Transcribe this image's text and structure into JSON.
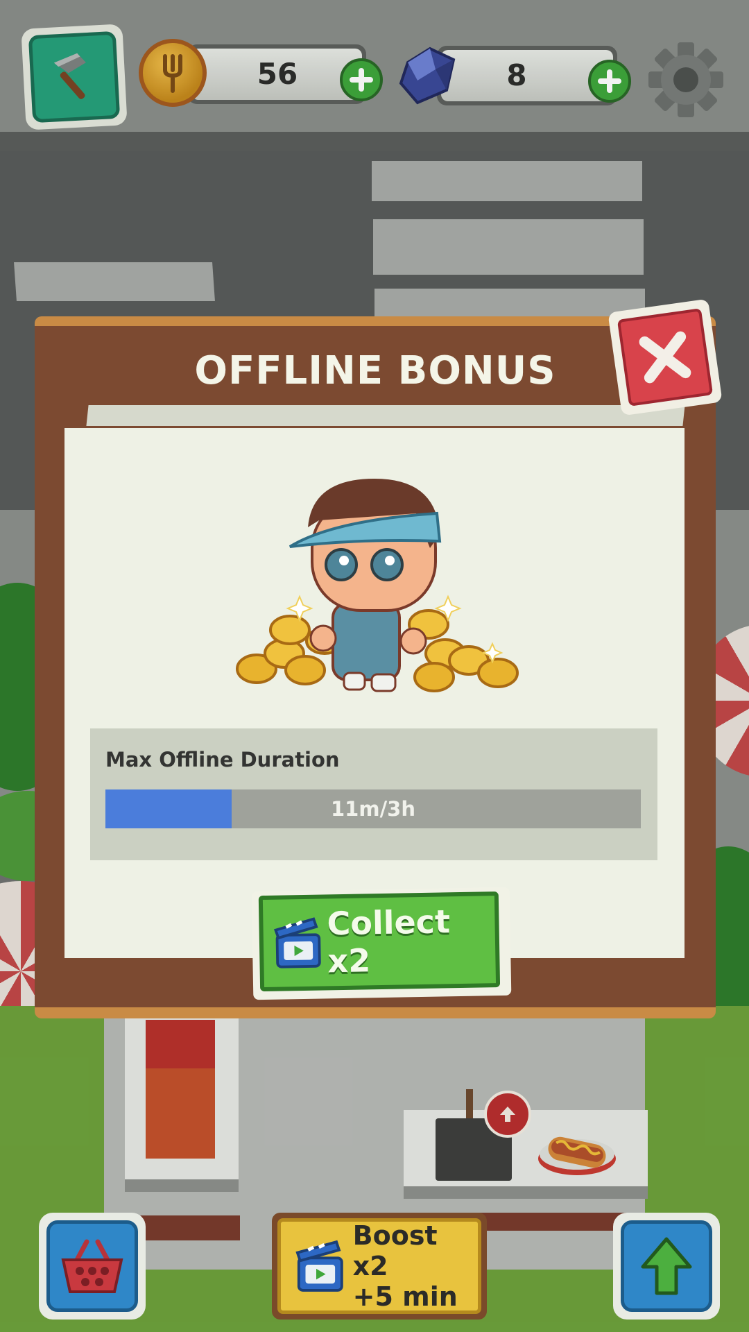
{
  "hud": {
    "coins": "56",
    "gems": "8"
  },
  "dialog": {
    "title": "OFFLINE BONUS",
    "duration_label": "Max Offline Duration",
    "duration_value": "11m/3h",
    "duration_progress": 0.236,
    "collect_label": "Collect x2"
  },
  "bottom": {
    "boost_line1": "Boost x2",
    "boost_line2": "+5 min"
  },
  "icons": {
    "build": "hammer-icon",
    "coin": "coin-icon",
    "gem": "gem-icon",
    "plus": "plus-icon",
    "settings": "gear-icon",
    "close": "close-icon",
    "video": "clapperboard-icon",
    "shop": "basket-icon",
    "upgrade": "arrow-up-icon"
  },
  "colors": {
    "progress_fill": "#4b7ddb",
    "collect_button": "#5fbf43",
    "close_button": "#d8434b",
    "dialog_frame": "#7c4a31"
  }
}
